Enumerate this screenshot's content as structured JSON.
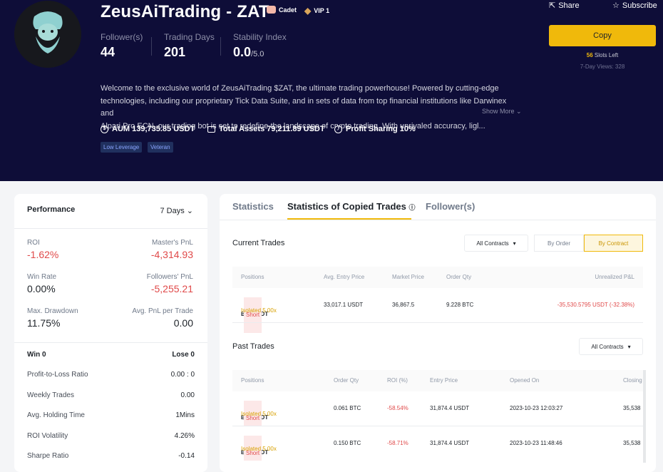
{
  "profile": {
    "name": "ZeusAiTrading - ZAT",
    "badge_cadet": "Cadet",
    "badge_vip": "VIP 1",
    "stats": [
      {
        "label": "Follower(s)",
        "value": "44",
        "suffix": ""
      },
      {
        "label": "Trading Days",
        "value": "201",
        "suffix": ""
      },
      {
        "label": "Stability Index",
        "value": "0.0",
        "suffix": "/5.0"
      }
    ],
    "description_line1": "Welcome to the exclusive world of ZeusAiTrading $ZAT, the ultimate trading powerhouse! Powered by cutting-edge",
    "description_line2": "technologies, including our proprietary Tick Data Suite, and in sets of data from top financial institutions like Darwinex and",
    "description_line3": "Alpari Pro ECN, our trading bot is set to redefine the landscape of crypto trading. With unrivaled accuracy, ligl...",
    "show_more": "Show More",
    "aum": "AUM 139,735.85 USDT",
    "total_assets": "Total Assets 79,211.89 USDT",
    "profit_sharing": "Profit Sharing 10%",
    "tags": [
      "Low Leverage",
      "Veteran"
    ]
  },
  "actions": {
    "share": "Share",
    "subscribe": "Subscribe",
    "copy": "Copy",
    "slots_num": "56",
    "slots_text": "Slots Left",
    "views": "7-Day Views: 328"
  },
  "performance": {
    "title": "Performance",
    "period": "7 Days",
    "roi_label": "ROI",
    "roi": "-1.62%",
    "master_pnl_label": "Master's PnL",
    "master_pnl": "-4,314.93",
    "winrate_label": "Win Rate",
    "winrate": "0.00%",
    "followers_pnl_label": "Followers' PnL",
    "followers_pnl": "-5,255.21",
    "drawdown_label": "Max. Drawdown",
    "drawdown": "11.75%",
    "avg_pnl_label": "Avg. PnL per Trade",
    "avg_pnl": "0.00",
    "rows": [
      {
        "label": "Win 0",
        "value": "Lose 0"
      },
      {
        "label": "Profit-to-Loss Ratio",
        "value": "0.00 : 0"
      },
      {
        "label": "Weekly Trades",
        "value": "0.00"
      },
      {
        "label": "Avg. Holding Time",
        "value": "1Mins"
      },
      {
        "label": "ROI Volatility",
        "value": "4.26%"
      },
      {
        "label": "Sharpe Ratio",
        "value": "-0.14"
      }
    ]
  },
  "tabs": {
    "statistics": "Statistics",
    "copied": "Statistics of Copied Trades",
    "followers": "Follower(s)"
  },
  "current": {
    "title": "Current Trades",
    "filter": "All Contracts",
    "by_order": "By Order",
    "by_contract": "By Contract",
    "headers": [
      "Positions",
      "Avg. Entry Price",
      "Market Price",
      "Order Qty",
      "Unrealized P&L"
    ],
    "rows": [
      {
        "symbol": "BTCUSDT",
        "side": "Short",
        "margin": "Isolated 5.00x",
        "entry": "33,017.1 USDT",
        "market": "36,867.5",
        "qty": "9.228 BTC",
        "pnl": "-35,530.5795 USDT (-32.38%)"
      }
    ]
  },
  "past": {
    "title": "Past Trades",
    "filter": "All Contracts",
    "headers": [
      "Positions",
      "Order Qty",
      "ROI (%)",
      "Entry Price",
      "Opened On",
      "Closing"
    ],
    "rows": [
      {
        "symbol": "BTCUSDT",
        "side": "Short",
        "margin": "Isolated 5.00x",
        "qty": "0.061 BTC",
        "roi": "-58.54%",
        "entry": "31,874.4 USDT",
        "opened": "2023-10-23 12:03:27",
        "closing": "35,538"
      },
      {
        "symbol": "BTCUSDT",
        "side": "Short",
        "margin": "Isolated 5.00x",
        "qty": "0.150 BTC",
        "roi": "-58.71%",
        "entry": "31,874.4 USDT",
        "opened": "2023-10-23 11:48:46",
        "closing": "35,538"
      }
    ]
  },
  "colors": {
    "accent": "#f0b90b",
    "negative": "#e04a4a",
    "hero_bg": "#0e0d38"
  }
}
